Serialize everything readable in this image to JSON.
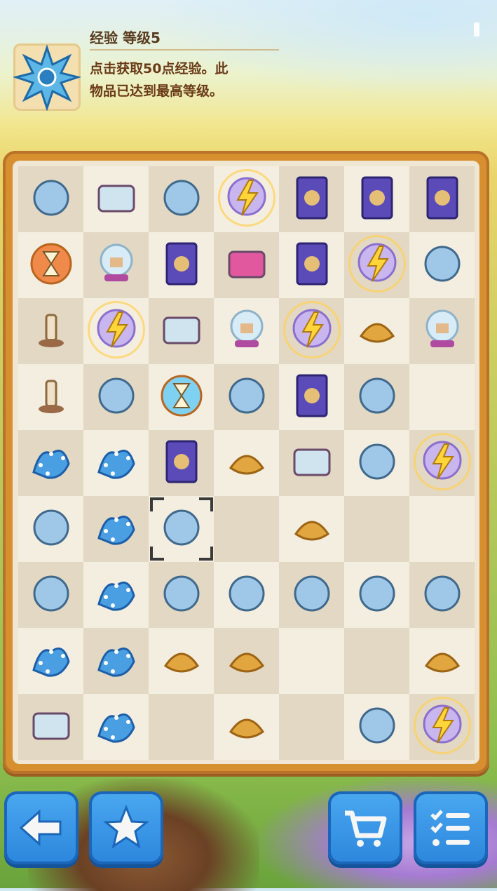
{
  "info": {
    "title": "经验 等级5",
    "description": "点击获取50点经验。此物品已达到最高等级。",
    "description_line1": "点击获取50点经验。此",
    "description_line2": "物品已达到最高等级。",
    "item_icon": "blue-star-flower-icon"
  },
  "colors": {
    "board_frame": "#d7902f",
    "button_blue": "#2c86dc",
    "title_text": "#5a3c1e",
    "desc_text": "#6a3a16"
  },
  "board": {
    "columns": 7,
    "rows": 9,
    "items": [
      [
        "slippers-icon",
        "cassette-tape-icon",
        "stage-theater-icon",
        "energy-crystal-ball-icon",
        "tarot-card-lion-icon",
        "tarot-card-castle-icon",
        "tarot-card-bird-icon"
      ],
      [
        "hourglass-orb-icon",
        "snow-globe-house-icon",
        "tarot-card-wizard-icon",
        "mb-treasure-chest-icon",
        "star-map-card-icon",
        "energy-crystal-ball-icon",
        "fortune-teller-table-icon"
      ],
      [
        "candle-icon",
        "energy-crystal-ball-icon",
        "book-stack-icon",
        "snow-globe-house-icon",
        "energy-crystal-ball-icon",
        "matchbox-icon",
        "snow-globe-house-icon"
      ],
      [
        "candelabra-icon",
        "potion-bottle-icon",
        "blue-hourglass-orb-icon",
        "crystal-cottage-icon",
        "zodiac-card-icon",
        "astro-badge-icon",
        ""
      ],
      [
        "bear-constellation-icon",
        "fist-constellation-icon",
        "zodiac-card-icon",
        "pie-slice-icon",
        "spell-book-icon",
        "bow-ribbon-icon",
        "energy-crystal-cottage-icon"
      ],
      [
        "graduation-gear-icon",
        "pegasus-constellation-icon",
        "blue-star-flower-icon",
        "",
        "pie-slice-icon",
        "",
        ""
      ],
      [
        "couple-statue-icon",
        "teddy-constellation-icon",
        "town-hall-icon",
        "telescope-icon",
        "amethyst-bowl-icon",
        "pocket-watch-icon",
        "armillary-sphere-icon"
      ],
      [
        "dog-constellation-icon",
        "basket-constellation-icon",
        "golden-ring-icon",
        "golden-stand-icon",
        "",
        "",
        "golden-fragment-icon"
      ],
      [
        "briefcase-icon",
        "archer-constellation-icon",
        "",
        "golden-fragment-icon",
        "",
        "quill-scroll-icon",
        "energy-gazebo-icon"
      ]
    ],
    "selected": "blue-star-flower-icon"
  },
  "buttons": {
    "back": "back-arrow-icon",
    "favorites": "star-icon",
    "shop": "shopping-cart-icon",
    "tasks": "checklist-icon"
  }
}
